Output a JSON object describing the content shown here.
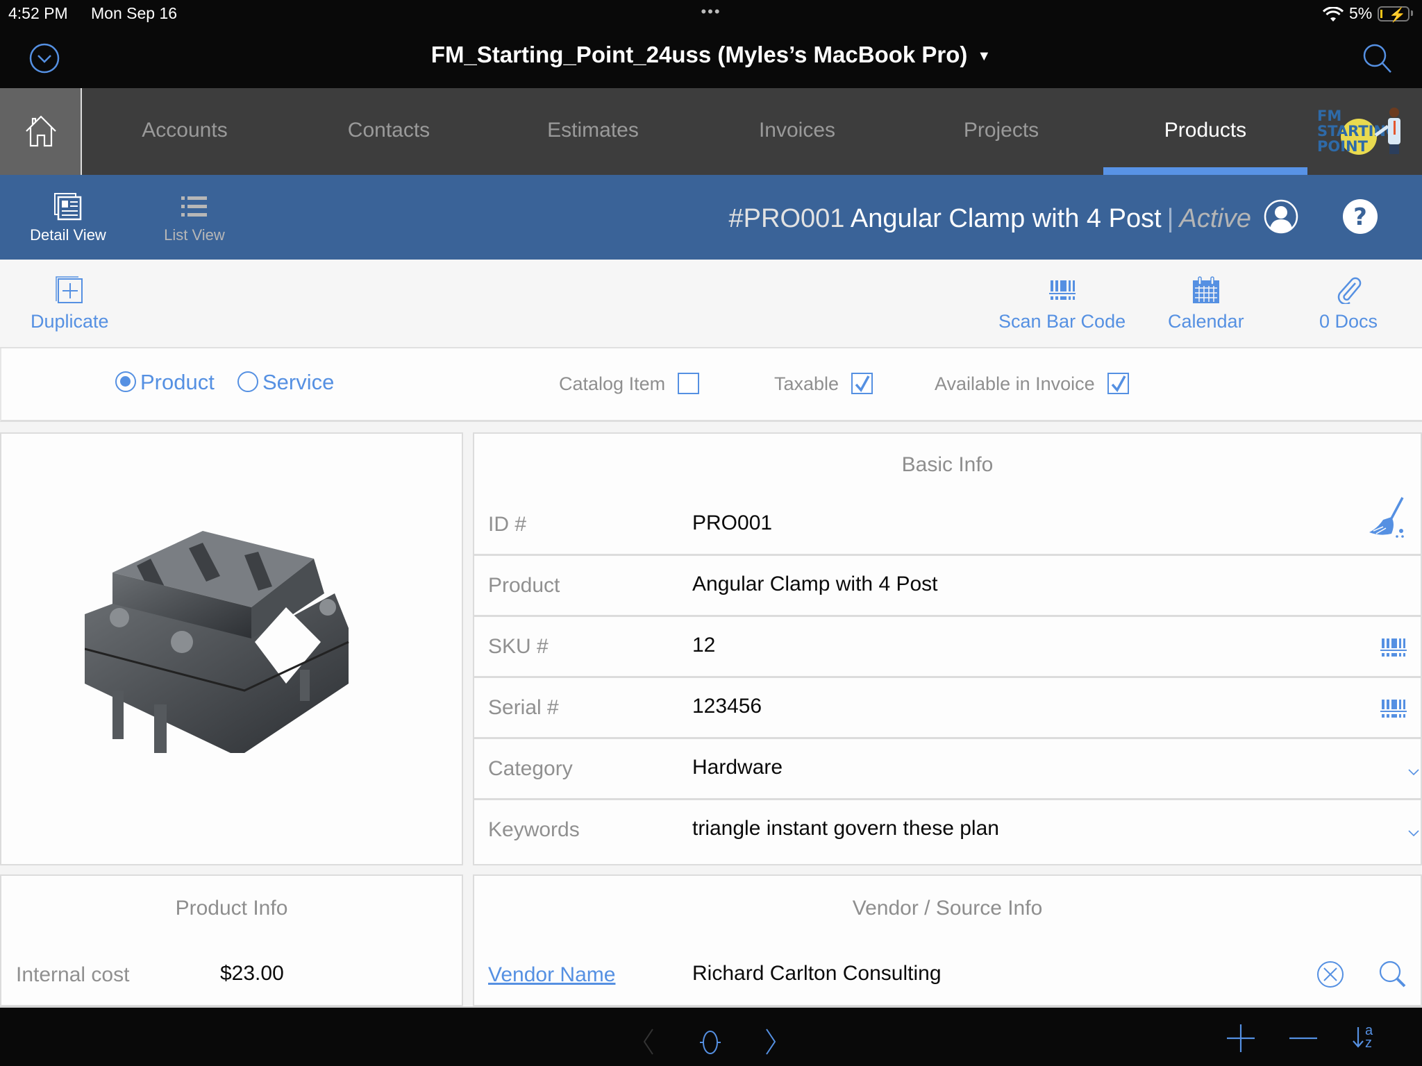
{
  "status_bar": {
    "time": "4:52 PM",
    "date": "Mon Sep 16",
    "multitask_dots": "•••",
    "battery_percent": "5%",
    "battery_level": 0.05,
    "charging": true
  },
  "title_bar": {
    "file_title": "FM_Starting_Point_24uss (Myles’s MacBook Pro)",
    "caret": "▼"
  },
  "nav": {
    "tabs": [
      {
        "label": "Accounts",
        "active": false
      },
      {
        "label": "Contacts",
        "active": false
      },
      {
        "label": "Estimates",
        "active": false
      },
      {
        "label": "Invoices",
        "active": false
      },
      {
        "label": "Projects",
        "active": false
      },
      {
        "label": "Products",
        "active": true
      }
    ],
    "logo_text": [
      "FM",
      "STARTING",
      "POINT"
    ]
  },
  "header": {
    "detail_view_label": "Detail View",
    "list_view_label": "List View",
    "record_id": "#PRO001",
    "record_name": "Angular Clamp with 4 Post",
    "separator": "|",
    "record_status": "Active"
  },
  "toolbar": {
    "duplicate_label": "Duplicate",
    "scan_label": "Scan Bar Code",
    "calendar_label": "Calendar",
    "docs_label": "0 Docs"
  },
  "options": {
    "type_options": [
      {
        "label": "Product",
        "selected": true
      },
      {
        "label": "Service",
        "selected": false
      }
    ],
    "checkboxes": [
      {
        "label": "Catalog Item",
        "checked": false
      },
      {
        "label": "Taxable",
        "checked": true
      },
      {
        "label": "Available in Invoice",
        "checked": true
      }
    ]
  },
  "basic_info": {
    "title": "Basic Info",
    "fields": [
      {
        "label": "ID #",
        "value": "PRO001",
        "icon": "broom-icon"
      },
      {
        "label": "Product",
        "value": "Angular Clamp with 4 Post",
        "icon": ""
      },
      {
        "label": "SKU #",
        "value": "12",
        "icon": "barcode-icon"
      },
      {
        "label": "Serial #",
        "value": "123456",
        "icon": "barcode-icon"
      },
      {
        "label": "Category",
        "value": "Hardware",
        "icon": "chevron-down-icon"
      },
      {
        "label": "Keywords",
        "value": "triangle instant govern these plan",
        "icon": "chevron-down-icon"
      }
    ]
  },
  "product_info": {
    "title": "Product Info",
    "internal_cost_label": "Internal cost",
    "internal_cost_value": "$23.00"
  },
  "vendor_info": {
    "title": "Vendor / Source Info",
    "vendor_name_label": "Vendor Name",
    "vendor_name_value": "Richard Carlton Consulting"
  },
  "bottom_bar": {
    "sort_label_top": "a",
    "sort_label_bottom": "z"
  },
  "colors": {
    "accent": "#5590e2",
    "header_blue": "#3a6398",
    "nav_bg": "#3d3d3d",
    "active_tab_indicator": "#5893e6"
  }
}
